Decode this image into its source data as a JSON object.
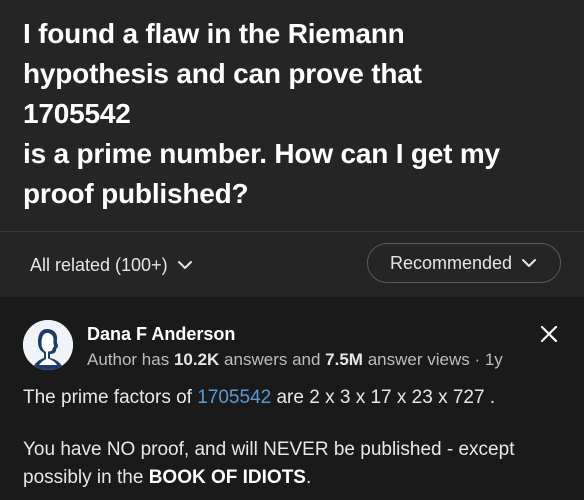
{
  "question": {
    "title_lines": [
      "I found a flaw in the Riemann",
      "hypothesis and can prove that",
      "1705542",
      "is a prime number. How can I get my",
      "proof published?"
    ]
  },
  "filters": {
    "all_related": "All related (100+)",
    "sort": "Recommended"
  },
  "answer": {
    "author_name": "Dana F Anderson",
    "meta_prefix": "Author has ",
    "answers_count": "10.2K",
    "meta_mid": " answers and ",
    "views_count": "7.5M",
    "meta_suffix": " answer views · 1y",
    "p1_prefix": "The prime factors of ",
    "p1_link": "1705542",
    "p1_suffix": " are 2 x 3 x 17 x 23 x 727 .",
    "p2_text": "You have NO proof, and will NEVER be published - except possibly in the ",
    "p2_bold": "BOOK OF IDIOTS",
    "p2_end": "."
  },
  "icons": {
    "chevron": "chevron-down-icon",
    "close": "close-icon",
    "avatar": "user-silhouette-icon"
  }
}
